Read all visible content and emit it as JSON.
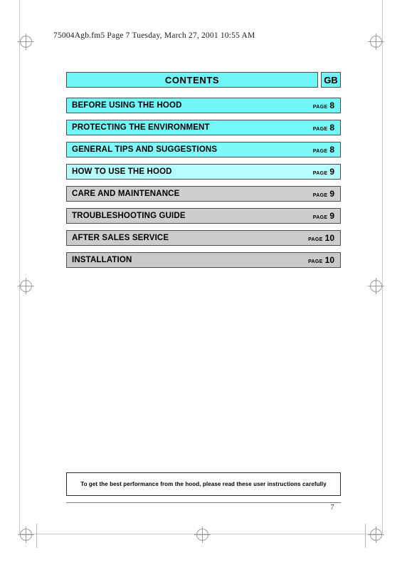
{
  "document": {
    "running_header": "75004Agb.fm5  Page 7  Tuesday, March 27, 2001  10:55 AM",
    "folio": "7"
  },
  "contents": {
    "title": "CONTENTS",
    "language_code": "GB",
    "page_word": "PAGE",
    "rows": [
      {
        "entry": "BEFORE USING THE HOOD",
        "page": "8"
      },
      {
        "entry": "PROTECTING THE ENVIRONMENT",
        "page": "8"
      },
      {
        "entry": "GENERAL TIPS AND SUGGESTIONS",
        "page": "8"
      },
      {
        "entry": "HOW TO USE THE HOOD",
        "page": "9"
      },
      {
        "entry": "CARE AND MAINTENANCE",
        "page": "9"
      },
      {
        "entry": "TROUBLESHOOTING GUIDE",
        "page": "9"
      },
      {
        "entry": "AFTER SALES SERVICE",
        "page": "10"
      },
      {
        "entry": "INSTALLATION",
        "page": "10"
      }
    ]
  },
  "note": {
    "text": "To get the best performance from the hood, please read these user instructions carefully"
  },
  "colors": {
    "highlight_cyan": "#6ff7f7",
    "row_grey": "#cccccc",
    "rule": "#4d4d4d"
  }
}
